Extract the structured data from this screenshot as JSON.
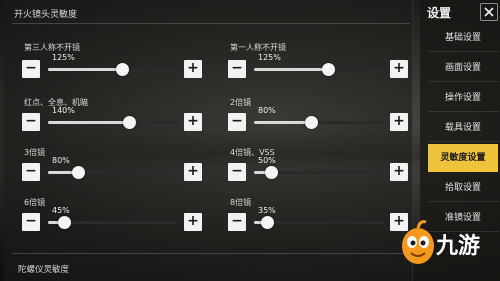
{
  "header": {
    "section_title": "开火镜头灵敏度"
  },
  "settings": [
    {
      "label": "第三人称不开镜",
      "value_text": "125%",
      "fraction": 0.57
    },
    {
      "label": "第一人称不开镜",
      "value_text": "125%",
      "fraction": 0.57
    },
    {
      "label": "红点、全息、机瞄",
      "value_text": "140%",
      "fraction": 0.62
    },
    {
      "label": "2倍镜",
      "value_text": "80%",
      "fraction": 0.44
    },
    {
      "label": "3倍镜",
      "value_text": "80%",
      "fraction": 0.23
    },
    {
      "label": "4倍镜、VSS",
      "value_text": "50%",
      "fraction": 0.13
    },
    {
      "label": "6倍镜",
      "value_text": "45%",
      "fraction": 0.12
    },
    {
      "label": "8倍镜",
      "value_text": "35%",
      "fraction": 0.1
    }
  ],
  "controls": {
    "minus_glyph": "−",
    "plus_glyph": "+"
  },
  "footer": {
    "gyro_title": "陀螺仪灵敏度"
  },
  "sidebar": {
    "title": "设置",
    "items": [
      {
        "label": "基础设置",
        "active": false
      },
      {
        "label": "画面设置",
        "active": false
      },
      {
        "label": "操作设置",
        "active": false
      },
      {
        "label": "载具设置",
        "active": false
      },
      {
        "label": "灵敏度设置",
        "active": true
      },
      {
        "label": "拾取设置",
        "active": false
      },
      {
        "label": "准镜设置",
        "active": false
      }
    ]
  },
  "watermark": {
    "text": "九游",
    "icon": "jiuyou-mascot-icon"
  },
  "colors": {
    "accent": "#f0c43a",
    "button_bg": "#f2f2f2",
    "logo_orange": "#f39a1e"
  }
}
